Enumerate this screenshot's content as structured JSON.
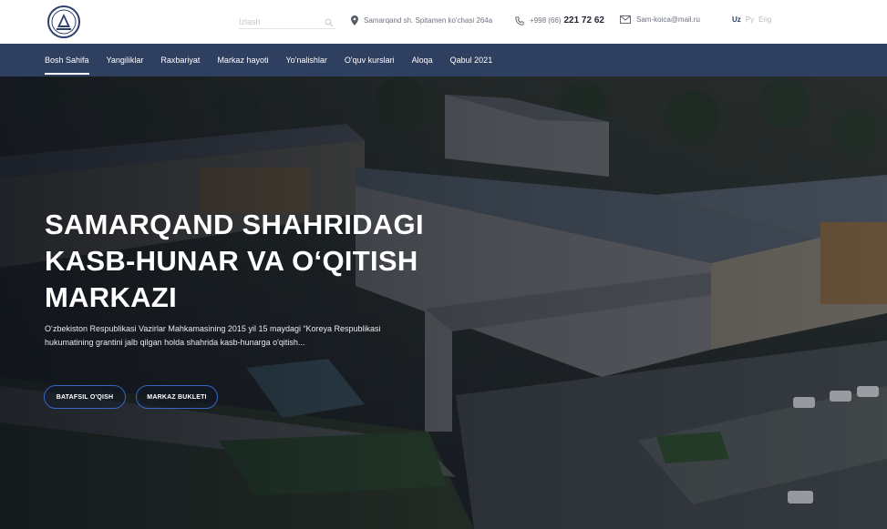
{
  "header": {
    "search_placeholder": "Izlash",
    "address": "Samarqand sh. Spitamen ko'chasi 264a",
    "phone_prefix": "+998 (66)",
    "phone_number": "221 72 62",
    "email": "Sam-koica@mail.ru",
    "languages": [
      {
        "label": "Uz",
        "active": true
      },
      {
        "label": "Ру",
        "active": false
      },
      {
        "label": "Eng",
        "active": false
      }
    ],
    "icons": {
      "logo": "logo-emblem",
      "search": "search-icon",
      "location": "location-pin-icon",
      "phone": "phone-icon",
      "mail": "mail-icon"
    }
  },
  "nav": {
    "items": [
      "Bosh Sahifa",
      "Yangiliklar",
      "Raxbariyat",
      "Markaz hayoti",
      "Yo'nalishlar",
      "O'quv kurslari",
      "Aloqa",
      "Qabul 2021"
    ],
    "active_index": 0
  },
  "hero": {
    "title": "SAMARQAND SHAHRIDAGI\nKASB-HUNAR VA O‘QITISH\nMARKAZI",
    "description": "O‘zbekiston Respublikasi Vazirlar Mahkamasining 2015 yil 15 maydagi “Koreya Respublikasi hukumatining grantini jalb qilgan holda shahrida kasb-hunarga o'qitish...",
    "buttons": [
      "BATAFSIL O'QISH",
      "MARKAZ BUKLETI"
    ]
  },
  "colors": {
    "nav_bg": "#2e3f60",
    "accent": "#3b63c9",
    "brand": "#2b3f6b"
  }
}
